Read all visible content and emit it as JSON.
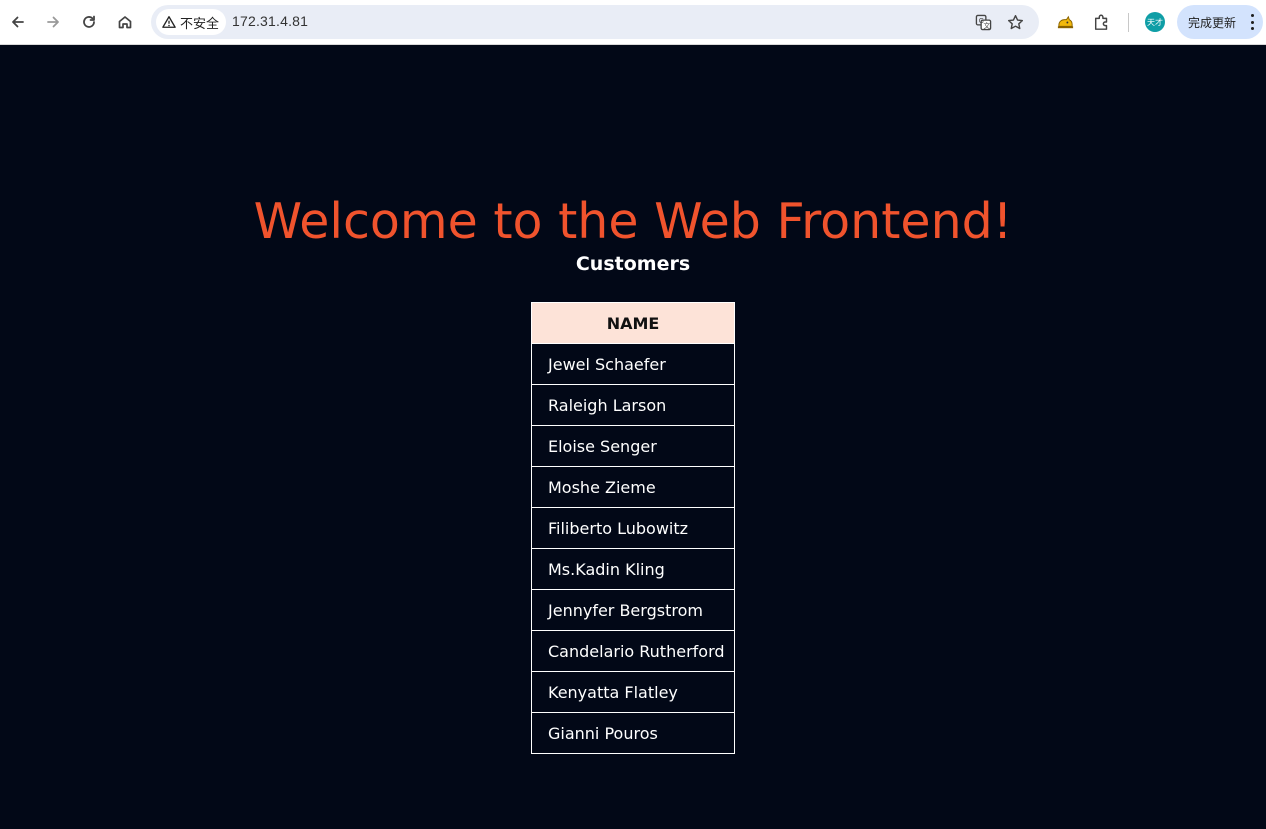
{
  "browser": {
    "security_label": "不安全",
    "url": "172.31.4.81",
    "avatar_text": "天才",
    "update_label": "完成更新"
  },
  "page": {
    "title": "Welcome to the Web Frontend!",
    "section_title": "Customers",
    "table": {
      "header": "NAME",
      "rows": [
        "Jewel Schaefer",
        "Raleigh Larson",
        "Eloise Senger",
        "Moshe Zieme",
        "Filiberto Lubowitz",
        "Ms.Kadin Kling",
        "Jennyfer Bergstrom",
        "Candelario Rutherford",
        "Kenyatta Flatley",
        "Gianni Pouros"
      ]
    }
  },
  "colors": {
    "background": "#020817",
    "title": "#f0532d",
    "table_header_bg": "#fde3d8"
  },
  "icons": {
    "back": "arrow-left-icon",
    "forward": "arrow-right-icon",
    "reload": "reload-icon",
    "home": "home-icon",
    "warning": "warning-triangle-icon",
    "translate": "translate-icon",
    "bookmark": "star-icon",
    "extension_app": "cat-extension-icon",
    "extensions": "puzzle-icon",
    "menu": "kebab-menu-icon"
  }
}
